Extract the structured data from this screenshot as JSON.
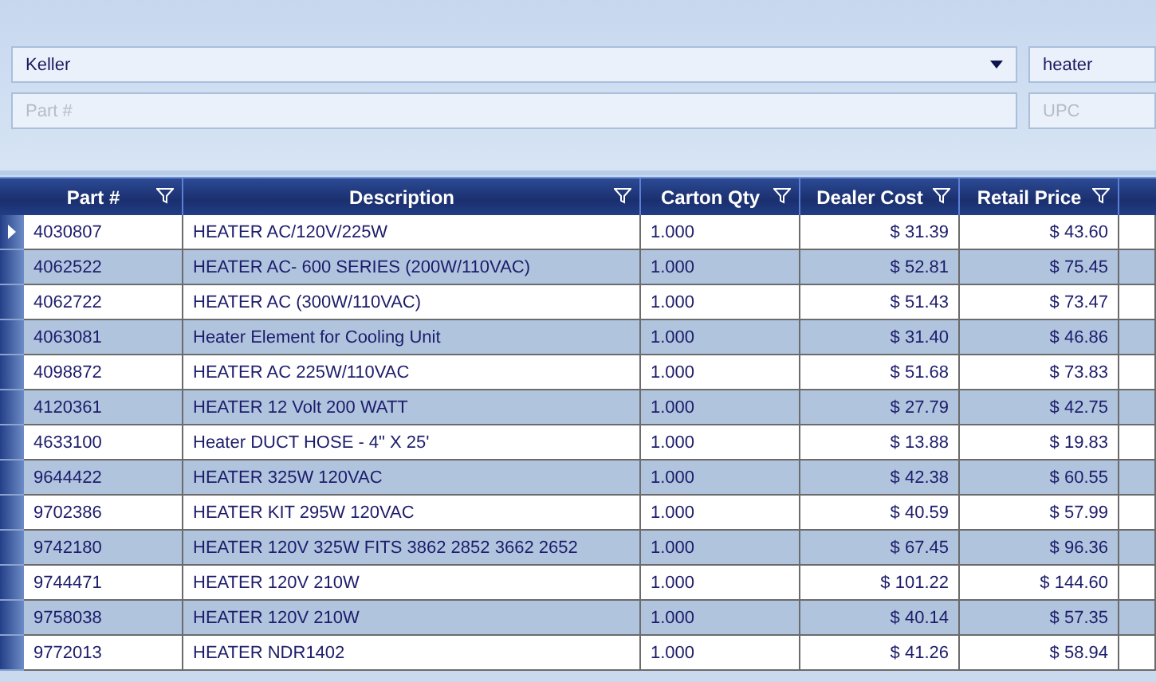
{
  "filters": {
    "dealer": {
      "value": "Keller"
    },
    "search": {
      "value": "heater"
    },
    "part_number": {
      "placeholder": "Part #"
    },
    "upc": {
      "placeholder": "UPC"
    }
  },
  "table": {
    "columns": [
      {
        "label": "Part #",
        "kind": "text"
      },
      {
        "label": "Description",
        "kind": "text"
      },
      {
        "label": "Carton Qty",
        "kind": "text"
      },
      {
        "label": "Dealer Cost",
        "kind": "money"
      },
      {
        "label": "Retail Price",
        "kind": "money"
      }
    ],
    "rows": [
      {
        "current": true,
        "cells": [
          "4030807",
          "HEATER AC/120V/225W",
          "1.000",
          "$ 31.39",
          "$ 43.60"
        ]
      },
      {
        "current": false,
        "cells": [
          "4062522",
          "HEATER AC- 600 SERIES (200W/110VAC)",
          "1.000",
          "$ 52.81",
          "$ 75.45"
        ]
      },
      {
        "current": false,
        "cells": [
          "4062722",
          "HEATER AC (300W/110VAC)",
          "1.000",
          "$ 51.43",
          "$ 73.47"
        ]
      },
      {
        "current": false,
        "cells": [
          "4063081",
          "Heater Element for Cooling Unit",
          "1.000",
          "$ 31.40",
          "$ 46.86"
        ]
      },
      {
        "current": false,
        "cells": [
          "4098872",
          "HEATER AC 225W/110VAC",
          "1.000",
          "$ 51.68",
          "$ 73.83"
        ]
      },
      {
        "current": false,
        "cells": [
          "4120361",
          "HEATER 12 Volt 200 WATT",
          "1.000",
          "$ 27.79",
          "$ 42.75"
        ]
      },
      {
        "current": false,
        "cells": [
          "4633100",
          "Heater DUCT HOSE - 4\" X 25'",
          "1.000",
          "$ 13.88",
          "$ 19.83"
        ]
      },
      {
        "current": false,
        "cells": [
          "9644422",
          "HEATER 325W 120VAC",
          "1.000",
          "$ 42.38",
          "$ 60.55"
        ]
      },
      {
        "current": false,
        "cells": [
          "9702386",
          "HEATER KIT 295W 120VAC",
          "1.000",
          "$ 40.59",
          "$ 57.99"
        ]
      },
      {
        "current": false,
        "cells": [
          "9742180",
          "HEATER 120V 325W FITS 3862 2852 3662 2652",
          "1.000",
          "$ 67.45",
          "$ 96.36"
        ]
      },
      {
        "current": false,
        "cells": [
          "9744471",
          "HEATER 120V 210W",
          "1.000",
          "$ 101.22",
          "$ 144.60"
        ]
      },
      {
        "current": false,
        "cells": [
          "9758038",
          "HEATER 120V 210W",
          "1.000",
          "$ 40.14",
          "$ 57.35"
        ]
      },
      {
        "current": false,
        "cells": [
          "9772013",
          "HEATER NDR1402",
          "1.000",
          "$ 41.26",
          "$ 58.94"
        ]
      }
    ]
  }
}
